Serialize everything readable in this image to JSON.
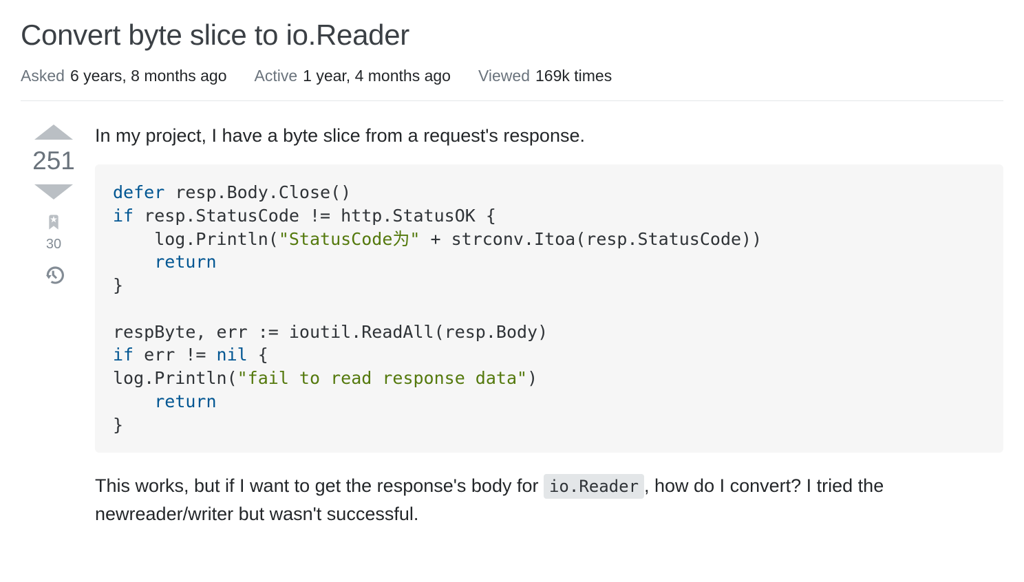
{
  "question": {
    "title": "Convert byte slice to io.Reader",
    "asked_label": "Asked",
    "asked_value": "6 years, 8 months ago",
    "active_label": "Active",
    "active_value": "1 year, 4 months ago",
    "viewed_label": "Viewed",
    "viewed_value": "169k times"
  },
  "votes": {
    "score": "251",
    "bookmarks": "30"
  },
  "post": {
    "intro": "In my project, I have a byte slice from a request's response.",
    "followup_part1": "This works, but if I want to get the response's body for ",
    "inline_code": "io.Reader",
    "followup_part2": ", how do I convert? I tried the newreader/writer but wasn't successful."
  },
  "code": {
    "line1_kw": "defer",
    "line1_rest": " resp.Body.Close()",
    "line2_kw": "if",
    "line2_rest": " resp.StatusCode != http.StatusOK {",
    "line3_pre": "    log.Println(",
    "line3_str": "\"StatusCode为\"",
    "line3_post": " + strconv.Itoa(resp.StatusCode))",
    "line4_indent": "    ",
    "line4_kw": "return",
    "line5": "}",
    "line7": "respByte, err := ioutil.ReadAll(resp.Body)",
    "line8_kw": "if",
    "line8_mid": " err != ",
    "line8_nil": "nil",
    "line8_end": " {",
    "line9_pre": "log.Println(",
    "line9_str": "\"fail to read response data\"",
    "line9_post": ")",
    "line10_indent": "    ",
    "line10_kw": "return",
    "line11": "}"
  }
}
